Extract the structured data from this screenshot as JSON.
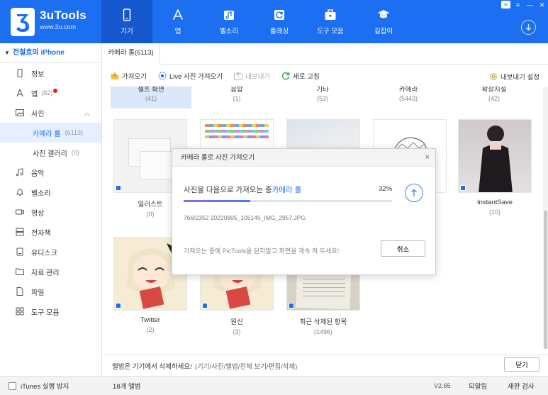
{
  "app": {
    "name": "3uTools",
    "url": "www.3u.com"
  },
  "nav": [
    {
      "label": "기기",
      "icon": "phone-icon"
    },
    {
      "label": "앱",
      "icon": "app-store-icon"
    },
    {
      "label": "벨소리",
      "icon": "music-note-icon"
    },
    {
      "label": "플래싱",
      "icon": "refresh-box-icon"
    },
    {
      "label": "도구 모음",
      "icon": "toolbox-icon"
    },
    {
      "label": "길잡이",
      "icon": "graduation-cap-icon"
    }
  ],
  "window_controls": {
    "badge": "≡"
  },
  "sidebar": {
    "device": "전철호의 iPhone",
    "items": [
      {
        "label": "정보",
        "icon": "phone-outline-icon"
      },
      {
        "label": "앱",
        "count": "(82)",
        "icon": "app-store-icon"
      },
      {
        "label": "사진",
        "icon": "image-icon"
      },
      {
        "label": "음악",
        "icon": "music-note-icon"
      },
      {
        "label": "벨소리",
        "icon": "bell-icon"
      },
      {
        "label": "영상",
        "icon": "video-icon"
      },
      {
        "label": "전자책",
        "icon": "book-icon"
      },
      {
        "label": "유디스크",
        "icon": "disk-icon"
      },
      {
        "label": "자료 관리",
        "icon": "folder-icon"
      },
      {
        "label": "파일",
        "icon": "file-icon"
      },
      {
        "label": "도구 모음",
        "icon": "grid-icon"
      }
    ],
    "photo_sub": [
      {
        "label": "카메라 롤",
        "count": "(6113)"
      },
      {
        "label": "사진 갤러리",
        "count": "(0)"
      }
    ]
  },
  "tab": "카메라 롤(6113)",
  "toolbar": {
    "import": "가져오기",
    "live_import": "Live 사진 가져오기",
    "export": "내보내기",
    "refresh": "새로 고침",
    "export_settings": "내보내기 설정"
  },
  "albums_top": [
    {
      "name": "셀프 화면",
      "count": "(41)"
    },
    {
      "name": "음밥",
      "count": "(1)"
    },
    {
      "name": "기타",
      "count": "(53)"
    },
    {
      "name": "카메라",
      "count": "(5443)"
    },
    {
      "name": "확장지설",
      "count": "(42)"
    }
  ],
  "albums": [
    {
      "name": "일러스트",
      "count": "(0)"
    },
    {
      "name": "",
      "count": ""
    },
    {
      "name": "",
      "count": ""
    },
    {
      "name": "",
      "count": ""
    },
    {
      "name": "InstantSave",
      "count": "(10)"
    },
    {
      "name": "Twitter",
      "count": "(2)"
    },
    {
      "name": "원신",
      "count": "(3)"
    },
    {
      "name": "최근 삭제된 항목",
      "count": "(1496)"
    }
  ],
  "bottom": {
    "message": "앨범은 기기에서 삭제하세요!",
    "hint": "(기기/사진/앨범/전체 보기/편집/삭제)",
    "close": "닫기"
  },
  "status": {
    "itunes": "iTunes 실행 방지",
    "albums": "18개 앨범",
    "version": "V2.65",
    "feedback": "되알림",
    "update": "새판 검사"
  },
  "modal": {
    "title": "카메라 롤로 사진 가져오기",
    "label_prefix": "사진을 다음으로 가져오는 중",
    "label_target": "카메라 롤",
    "progress_text": "32%",
    "progress": 0.32,
    "file": "766/2352 20220805_105145_IMG_2957.JPG",
    "warning": "가져오는 중에 PicTools을 닫지말고 화면을 계속 켜 두세요!",
    "cancel": "취소",
    "close": "×"
  },
  "colors": {
    "brand": "#1d6ff2",
    "notification": "#e02020"
  }
}
